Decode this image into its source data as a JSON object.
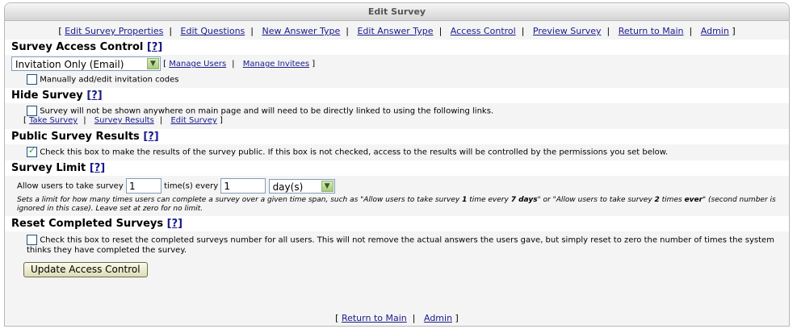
{
  "window": {
    "title": "Edit Survey"
  },
  "top_nav": [
    "Edit Survey Properties",
    "Edit Questions",
    "New Answer Type",
    "Edit Answer Type",
    "Access Control",
    "Preview Survey",
    "Return to Main",
    "Admin"
  ],
  "help": "[?]",
  "access_control": {
    "title": "Survey Access Control",
    "selected": "Invitation Only (Email)",
    "link_users": "Manage Users",
    "link_invitees": "Manage Invitees",
    "manual_codes_label": "Manually add/edit invitation codes"
  },
  "hide_survey": {
    "title": "Hide Survey",
    "label": "Survey will not be shown anywhere on main page and will need to be directly linked to using the following links.",
    "links": [
      "Take Survey",
      "Survey Results",
      "Edit Survey"
    ]
  },
  "public_results": {
    "title": "Public Survey Results",
    "checked": true,
    "label": "Check this box to make the results of the survey public. If this box is not checked, access to the results will be controlled by the permissions you set below."
  },
  "survey_limit": {
    "title": "Survey Limit",
    "prefix": "Allow users to take survey",
    "times_value": "1",
    "middle": "time(s) every",
    "span_value": "1",
    "unit": "day(s)",
    "note_a": "Sets a limit for how many times users can complete a survey over a given time span, such as \"Allow users to take survey ",
    "note_b": "1",
    "note_c": " time every ",
    "note_d": "7 days",
    "note_e": "\" or \"Allow users to take survey ",
    "note_f": "2",
    "note_g": " times ",
    "note_h": "ever",
    "note_i": "\" (second number is ignored in this case). Leave set at zero for no limit."
  },
  "reset": {
    "title": "Reset Completed Surveys",
    "label": "Check this box to reset the completed surveys number for all users. This will not remove the actual answers the users gave, but simply reset to zero the number of times the system thinks they have completed the survey."
  },
  "submit_label": "Update Access Control",
  "footer_nav": [
    "Return to Main",
    "Admin"
  ]
}
